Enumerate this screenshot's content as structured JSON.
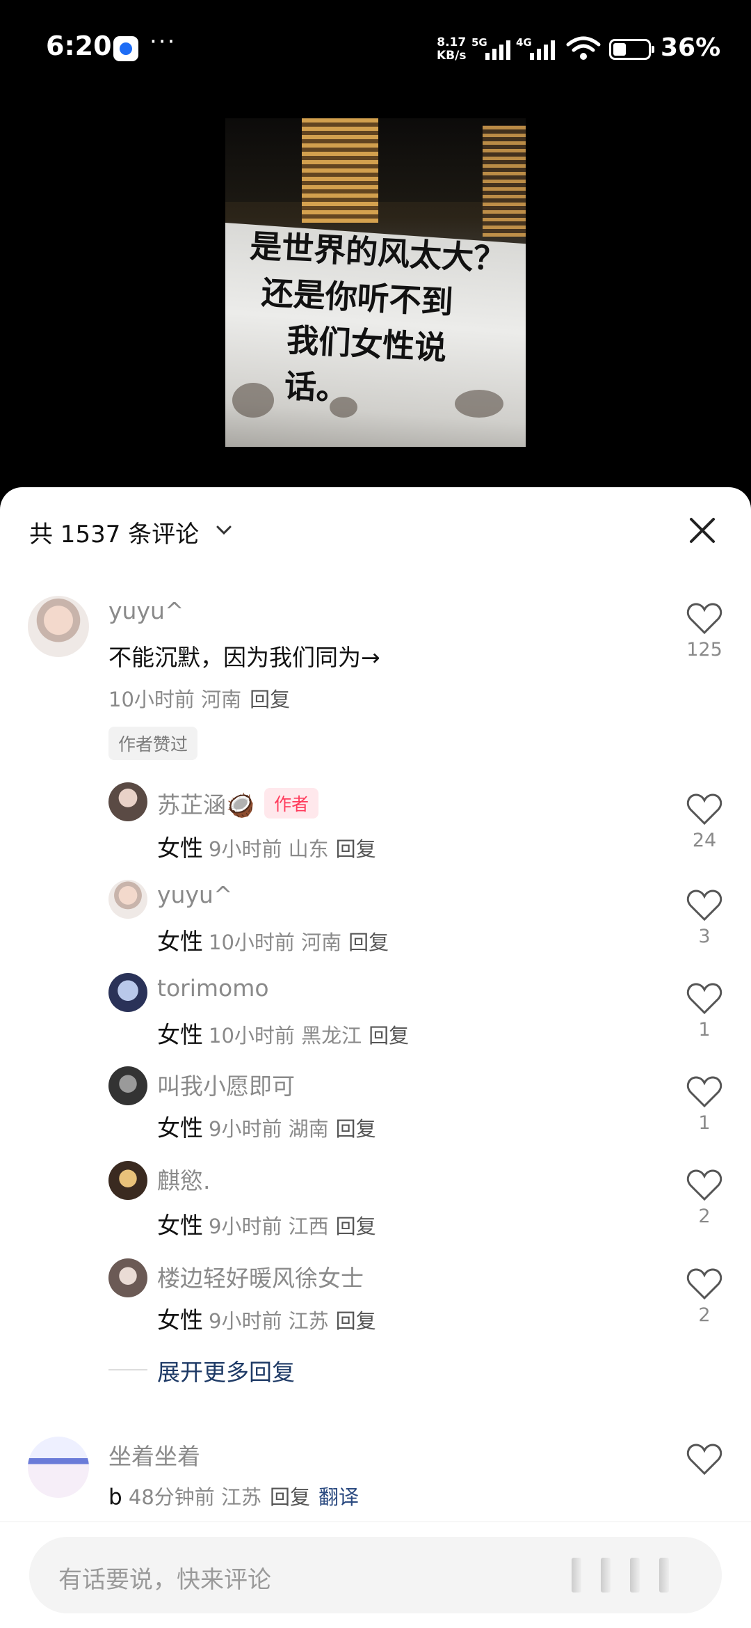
{
  "status_bar": {
    "time": "6:20",
    "dots": "···",
    "speed_value": "8.17",
    "speed_unit": "KB/s",
    "signal1_label": "5G",
    "signal2_label": "4G",
    "battery": "36%"
  },
  "post": {
    "image_text": [
      "是世界的风太大？",
      "还是你听不到",
      "我们女性说话。"
    ]
  },
  "sheet": {
    "title": "共 1537 条评论",
    "expand_label": "展开更多回复"
  },
  "comments": [
    {
      "name": "yuyu^",
      "text": "不能沉默，因为我们同为→",
      "meta": "10小时前 河南",
      "reply": "回复",
      "pill": "作者赞过",
      "likes": "125"
    },
    {
      "name": "坐着坐着",
      "text_meta_prefix": "b",
      "meta": "48分钟前 江苏",
      "reply": "回复",
      "translate": "翻译"
    }
  ],
  "replies": [
    {
      "name": "苏芷涵🥥",
      "badge": "作者",
      "lead": "女性",
      "meta": "9小时前 山东",
      "reply": "回复",
      "likes": "24"
    },
    {
      "name": "yuyu^",
      "lead": "女性",
      "meta": "10小时前 河南",
      "reply": "回复",
      "likes": "3"
    },
    {
      "name": "torimomo",
      "lead": "女性",
      "meta": "10小时前 黑龙江",
      "reply": "回复",
      "likes": "1"
    },
    {
      "name": "叫我小愿即可",
      "lead": "女性",
      "meta": "9小时前 湖南",
      "reply": "回复",
      "likes": "1"
    },
    {
      "name": "麒慾.",
      "lead": "女性",
      "meta": "9小时前 江西",
      "reply": "回复",
      "likes": "2"
    },
    {
      "name": "楼边轻好暖风徐女士",
      "lead": "女性",
      "meta": "9小时前 江苏",
      "reply": "回复",
      "likes": "2"
    }
  ],
  "input": {
    "placeholder": "有话要说，快来评论"
  },
  "icons": {
    "heart": "heart-icon",
    "close": "close-icon",
    "chevron": "chevron-down-icon"
  }
}
